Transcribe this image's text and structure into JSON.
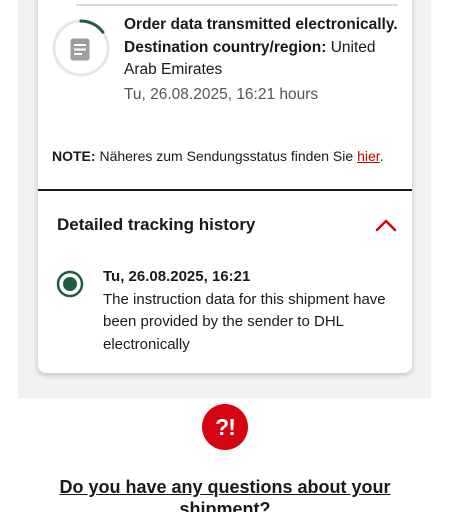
{
  "status": {
    "title": "Order data transmitted electronically.",
    "destination_label": "Destination country/region:",
    "destination_value": "United Arab Emirates",
    "date": "Tu, 26.08.2025, 16:21 hours",
    "progress": 0.15
  },
  "note": {
    "label": "NOTE:",
    "text": "Näheres zum Sendungsstatus finden Sie",
    "link": "hier",
    "suffix": "."
  },
  "history": {
    "title": "Detailed tracking history",
    "events": [
      {
        "date": "Tu, 26.08.2025, 16:21",
        "description": "The instruction data for this shipment have been provided by the sender to DHL electronically"
      }
    ]
  },
  "help": {
    "icon_text": "?!",
    "question": "Do you have any questions about your shipment?"
  },
  "colors": {
    "accent_red": "#d40511",
    "link_red": "#c40000",
    "active_green": "#1f5c3f"
  },
  "icons": {
    "status": "document-icon",
    "collapse": "chevron-up-icon",
    "event": "radio-selected-icon",
    "help": "question-exclamation-icon"
  }
}
